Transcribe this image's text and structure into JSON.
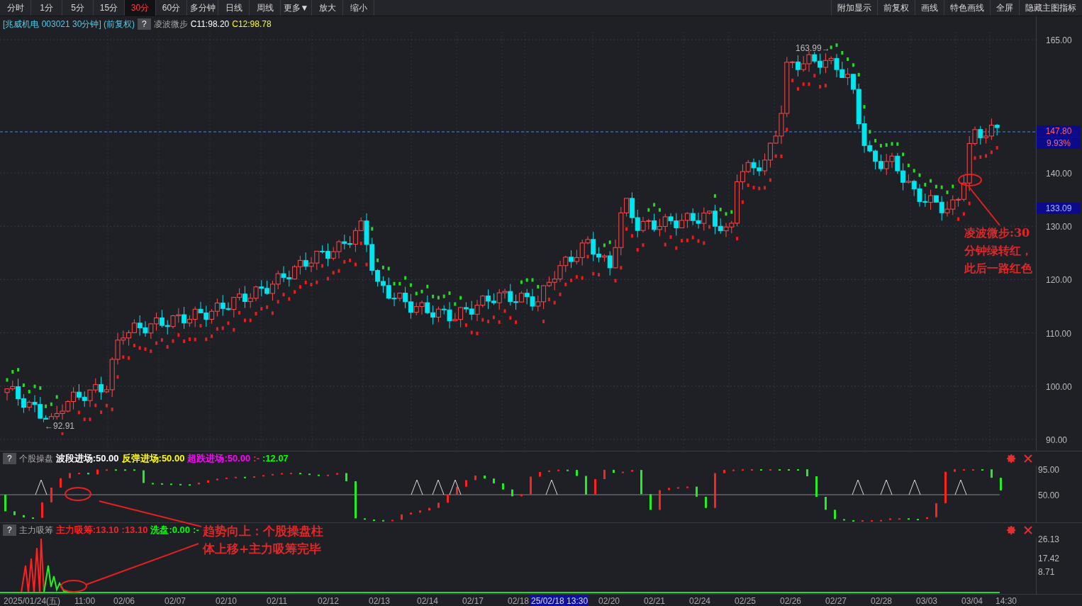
{
  "toolbar": {
    "left_tabs": [
      {
        "label": "分时",
        "selected": false
      },
      {
        "label": "1分",
        "selected": false
      },
      {
        "label": "5分",
        "selected": false
      },
      {
        "label": "15分",
        "selected": false
      },
      {
        "label": "30分",
        "selected": true
      },
      {
        "label": "60分",
        "selected": false
      },
      {
        "label": "多分钟",
        "selected": false
      },
      {
        "label": "日线",
        "selected": false
      },
      {
        "label": "周线",
        "selected": false
      },
      {
        "label": "更多▼",
        "selected": false
      },
      {
        "label": "放大",
        "selected": false
      },
      {
        "label": "缩小",
        "selected": false
      }
    ],
    "right_buttons": [
      "附加显示",
      "前复权",
      "画线",
      "特色画线",
      "全屏",
      "隐藏主图指标"
    ]
  },
  "main_chart": {
    "title": "[兆威机电 003021 30分钟] (前复权)",
    "help": "?",
    "indicator": "凌波微步",
    "legend": [
      {
        "text": "C11:98.20",
        "color": "#ffffff"
      },
      {
        "text": "C12:98.78",
        "color": "#ffff00"
      }
    ],
    "high_label": "163.99→",
    "low_label": "←92.91",
    "price_axis": [
      "165.00",
      "140.00",
      "130.00",
      "120.00",
      "110.00",
      "100.00",
      "90.00"
    ],
    "tags": [
      {
        "text": "147.80",
        "kind": "current"
      },
      {
        "text": "9.93%",
        "kind": "current"
      },
      {
        "text": "133.09",
        "kind": "marker"
      }
    ],
    "annotation": [
      "凌波微步:30",
      "分钟绿转红，",
      "此后一路红色"
    ]
  },
  "panel_1": {
    "help": "?",
    "name": "个股操盘",
    "legend": [
      {
        "text": "波段进场:50.00",
        "color": "#ffffff"
      },
      {
        "text": "反弹进场:50.00",
        "color": "#ffff00"
      },
      {
        "text": "超跌进场:50.00",
        "color": "#ff00ff"
      },
      {
        "text": ":-",
        "color": "#ff3030"
      },
      {
        "text": ":12.07",
        "color": "#00ff00"
      }
    ],
    "axis": [
      "95.00",
      "50.00"
    ]
  },
  "panel_2": {
    "help": "?",
    "name": "主力吸筹",
    "legend": [
      {
        "text": "主力吸筹:13.10",
        "color": "#ff2020"
      },
      {
        "text": ":13.10",
        "color": "#ff2020"
      },
      {
        "text": "洗盘:0.00",
        "color": "#00ff00"
      },
      {
        "text": ":-",
        "color": "#00ff00"
      }
    ],
    "axis": [
      "26.13",
      "17.42",
      "8.71"
    ],
    "annotation": [
      "趋势向上：个股操盘柱",
      "体上移+主力吸筹完毕"
    ]
  },
  "time_axis": [
    {
      "text": "2025/01/24(五)",
      "selected": false
    },
    {
      "text": "11:00",
      "selected": false
    },
    {
      "text": "02/06",
      "selected": false
    },
    {
      "text": "02/07",
      "selected": false
    },
    {
      "text": "02/10",
      "selected": false
    },
    {
      "text": "02/11",
      "selected": false
    },
    {
      "text": "02/12",
      "selected": false
    },
    {
      "text": "02/13",
      "selected": false
    },
    {
      "text": "02/14",
      "selected": false
    },
    {
      "text": "02/17",
      "selected": false
    },
    {
      "text": "02/18",
      "selected": false
    },
    {
      "text": "25/02/18 13:30",
      "selected": true
    },
    {
      "text": "02/20",
      "selected": false
    },
    {
      "text": "02/21",
      "selected": false
    },
    {
      "text": "02/24",
      "selected": false
    },
    {
      "text": "02/25",
      "selected": false
    },
    {
      "text": "02/26",
      "selected": false
    },
    {
      "text": "02/27",
      "selected": false
    },
    {
      "text": "02/28",
      "selected": false
    },
    {
      "text": "03/03",
      "selected": false
    },
    {
      "text": "03/04",
      "selected": false
    },
    {
      "text": "14:30",
      "selected": false
    }
  ]
}
